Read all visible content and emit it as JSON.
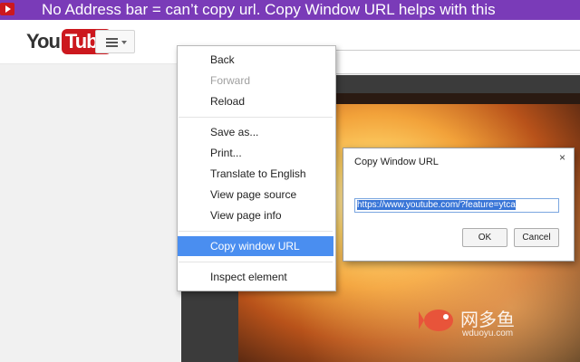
{
  "banner": {
    "text": "No Address bar = can’t copy url. Copy Window URL helps with this"
  },
  "masthead": {
    "logo_you": "You",
    "logo_tube": "Tube"
  },
  "context_menu": {
    "items": [
      {
        "label": "Back",
        "state": "normal"
      },
      {
        "label": "Forward",
        "state": "disabled"
      },
      {
        "label": "Reload",
        "state": "normal"
      },
      {
        "label": "Save as...",
        "state": "normal"
      },
      {
        "label": "Print...",
        "state": "normal"
      },
      {
        "label": "Translate to English",
        "state": "normal"
      },
      {
        "label": "View page source",
        "state": "normal"
      },
      {
        "label": "View page info",
        "state": "normal"
      },
      {
        "label": "Copy window URL",
        "state": "selected"
      },
      {
        "label": "Inspect element",
        "state": "normal"
      }
    ]
  },
  "dialog": {
    "title": "Copy Window URL",
    "close": "×",
    "url": "https://www.youtube.com/?feature=ytca",
    "ok_label": "OK",
    "cancel_label": "Cancel"
  },
  "watermark": {
    "cn": "网多鱼",
    "url": "wduoyu.com"
  },
  "colors": {
    "banner": "#7a3bb8",
    "youtube_red": "#cc181e",
    "selection": "#4a8ef0"
  }
}
